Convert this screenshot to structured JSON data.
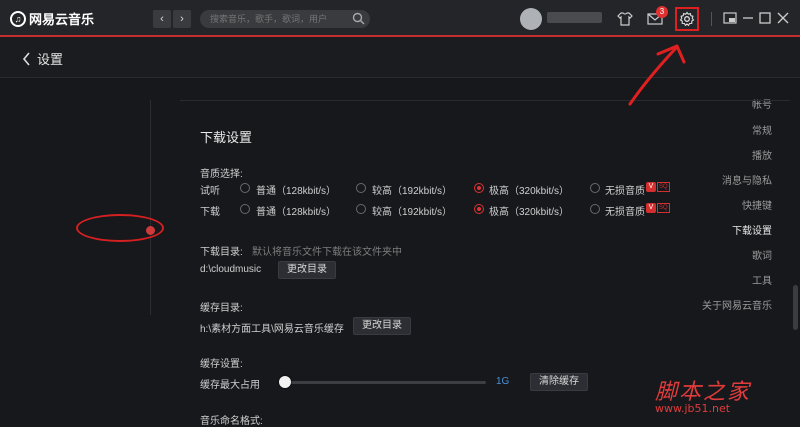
{
  "app": {
    "name": "网易云音乐",
    "logo_mark": "♫"
  },
  "nav_buttons": {
    "back": "‹",
    "forward": "›"
  },
  "search": {
    "placeholder": "搜索音乐，歌手，歌词，用户"
  },
  "topbar": {
    "mail_badge": "3"
  },
  "subheader": {
    "title": "设置"
  },
  "sidebar": {
    "items": [
      {
        "label": "帐号"
      },
      {
        "label": "常规"
      },
      {
        "label": "播放"
      },
      {
        "label": "消息与隐私"
      },
      {
        "label": "快捷键"
      },
      {
        "label": "下载设置"
      },
      {
        "label": "歌词"
      },
      {
        "label": "工具"
      },
      {
        "label": "关于网易云音乐"
      }
    ],
    "active_index": 5
  },
  "download": {
    "heading": "下载设置",
    "quality": {
      "label": "音质选择:",
      "rows": [
        {
          "label": "试听",
          "options": [
            "普通（128kbit/s）",
            "较高（192kbit/s）",
            "极高（320kbit/s）",
            "无损音质"
          ],
          "selected": 2
        },
        {
          "label": "下载",
          "options": [
            "普通（128kbit/s）",
            "较高（192kbit/s）",
            "极高（320kbit/s）",
            "无损音质"
          ],
          "selected": 2
        }
      ],
      "vip_badge": "V",
      "sq_tag": "SQ"
    },
    "dir": {
      "label": "下载目录:",
      "hint": "默认将音乐文件下载在该文件夹中",
      "path": "d:\\cloudmusic",
      "button": "更改目录"
    },
    "cache_dir": {
      "label": "缓存目录:",
      "path": "h:\\素材方面工具\\网易云音乐缓存",
      "button": "更改目录"
    },
    "cache": {
      "label": "缓存设置:",
      "max_label": "缓存最大占用",
      "value": "1G",
      "level": 0.01,
      "clear_button": "清除缓存"
    },
    "naming": {
      "label": "音乐命名格式:"
    }
  },
  "watermark": {
    "cn": "脚本之家",
    "url": "www.jb51.net"
  },
  "colors": {
    "accent": "#c62f2f",
    "annotation": "#e02020",
    "link": "#4a8fd8"
  }
}
